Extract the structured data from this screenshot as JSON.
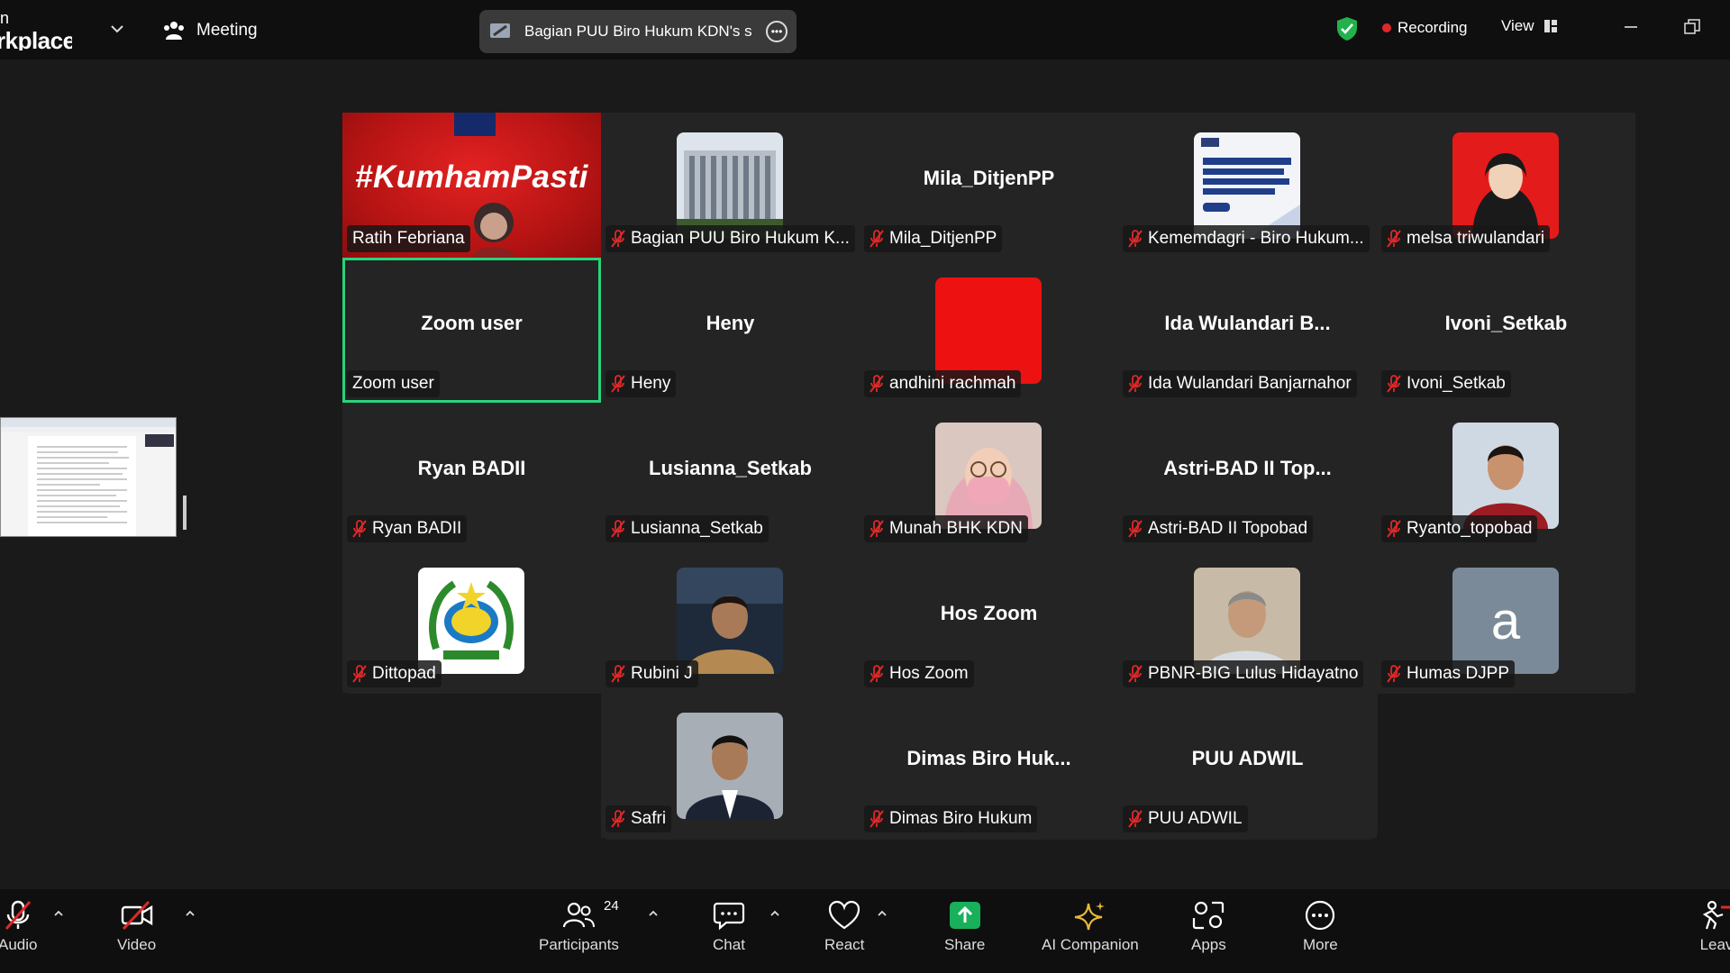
{
  "topbar": {
    "app_name_line1": "n",
    "app_name_line2": "rkplace",
    "meeting_label": "Meeting",
    "share_title": "Bagian PUU Biro Hukum KDN's s",
    "recording_label": "Recording",
    "view_label": "View"
  },
  "tiles": [
    {
      "label": "Ratih Febriana",
      "muted": false
    },
    {
      "label": "Bagian PUU Biro Hukum K...",
      "muted": true
    },
    {
      "big": "Mila_DitjenPP",
      "label": "Mila_DitjenPP",
      "muted": true
    },
    {
      "label": "Kememdagri - Biro Hukum...",
      "muted": true
    },
    {
      "label": "melsa triwulandari",
      "muted": true
    },
    {
      "big": "Zoom user",
      "label": "Zoom user",
      "muted": false
    },
    {
      "big": "Heny",
      "label": "Heny",
      "muted": true
    },
    {
      "label": "andhini rachmah",
      "muted": true
    },
    {
      "big": "Ida Wulandari B...",
      "label": "Ida Wulandari Banjarnahor",
      "muted": true
    },
    {
      "big": "Ivoni_Setkab",
      "label": "Ivoni_Setkab",
      "muted": true
    },
    {
      "big": "Ryan BADII",
      "label": "Ryan BADII",
      "muted": true
    },
    {
      "big": "Lusianna_Setkab",
      "label": "Lusianna_Setkab",
      "muted": true
    },
    {
      "label": "Munah BHK KDN",
      "muted": true
    },
    {
      "big": "Astri-BAD II Top...",
      "label": "Astri-BAD II Topobad",
      "muted": true
    },
    {
      "label": "Ryanto_topobad",
      "muted": true
    },
    {
      "label": "Dittopad",
      "muted": true
    },
    {
      "label": "Rubini J",
      "muted": true
    },
    {
      "big": "Hos Zoom",
      "label": "Hos Zoom",
      "muted": true
    },
    {
      "label": "PBNR-BIG Lulus Hidayatno",
      "muted": true
    },
    {
      "label": "Humas DJPP",
      "muted": true,
      "letter": "a"
    },
    {
      "label": "Safri",
      "muted": true
    },
    {
      "big": "Dimas Biro Huk...",
      "label": "Dimas Biro Hukum",
      "muted": true
    },
    {
      "big": "PUU ADWIL",
      "label": "PUU ADWIL",
      "muted": true
    }
  ],
  "kumham_text": "#KumhamPasti",
  "toolbar": {
    "audio": "Audio",
    "video": "Video",
    "participants": "Participants",
    "participants_count": "24",
    "chat": "Chat",
    "react": "React",
    "share": "Share",
    "ai_companion": "AI Companion",
    "apps": "Apps",
    "more": "More",
    "leave": "Leav"
  },
  "colors": {
    "active_speaker": "#2bd27a",
    "share_green": "#19b05b",
    "muted_red": "#e02828",
    "ai_gold": "#e8b93a"
  }
}
